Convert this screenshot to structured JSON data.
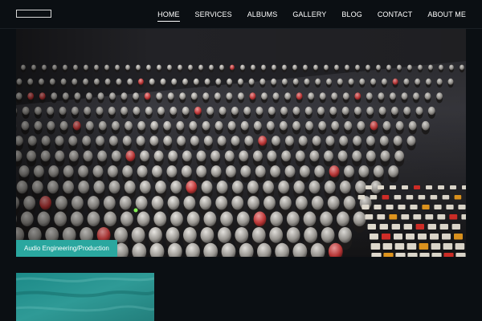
{
  "nav": {
    "items": [
      {
        "label": "HOME",
        "active": true
      },
      {
        "label": "SERVICES",
        "active": false
      },
      {
        "label": "ALBUMS",
        "active": false
      },
      {
        "label": "GALLERY",
        "active": false
      },
      {
        "label": "BLOG",
        "active": false
      },
      {
        "label": "CONTACT",
        "active": false
      },
      {
        "label": "ABOUT ME",
        "active": false
      }
    ]
  },
  "hero": {
    "caption": "Audio Engineering/Production"
  },
  "colors": {
    "background": "#0b0f13",
    "accent": "#2aa79f"
  }
}
